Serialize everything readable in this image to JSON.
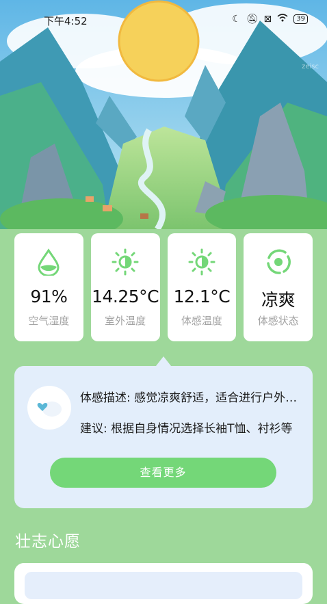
{
  "status_bar": {
    "time": "下午4:52",
    "battery": "39",
    "icons": [
      "moon-icon",
      "bell-off-icon",
      "sim-off-icon",
      "wifi-icon",
      "battery-icon"
    ]
  },
  "hero": {
    "watermark": "zeisc"
  },
  "cards": [
    {
      "value": "91%",
      "label": "空气湿度",
      "icon": "water-drop-icon"
    },
    {
      "value": "14.25°C",
      "label": "室外温度",
      "icon": "sun-icon"
    },
    {
      "value": "12.1°C",
      "label": "体感温度",
      "icon": "sun-icon"
    },
    {
      "value": "凉爽",
      "label": "体感状态",
      "icon": "comfort-ring-icon"
    }
  ],
  "detail": {
    "description": "体感描述: 感觉凉爽舒适，适合进行户外活动",
    "suggestion": "建议: 根据自身情况选择长袖T恤、衬衫等",
    "more_button": "查看更多"
  },
  "section": {
    "title": "壮志心愿"
  },
  "colors": {
    "background": "#9ed89a",
    "accent": "#74d778",
    "panel": "#e3eefb",
    "card_label": "#a3a3a3"
  }
}
